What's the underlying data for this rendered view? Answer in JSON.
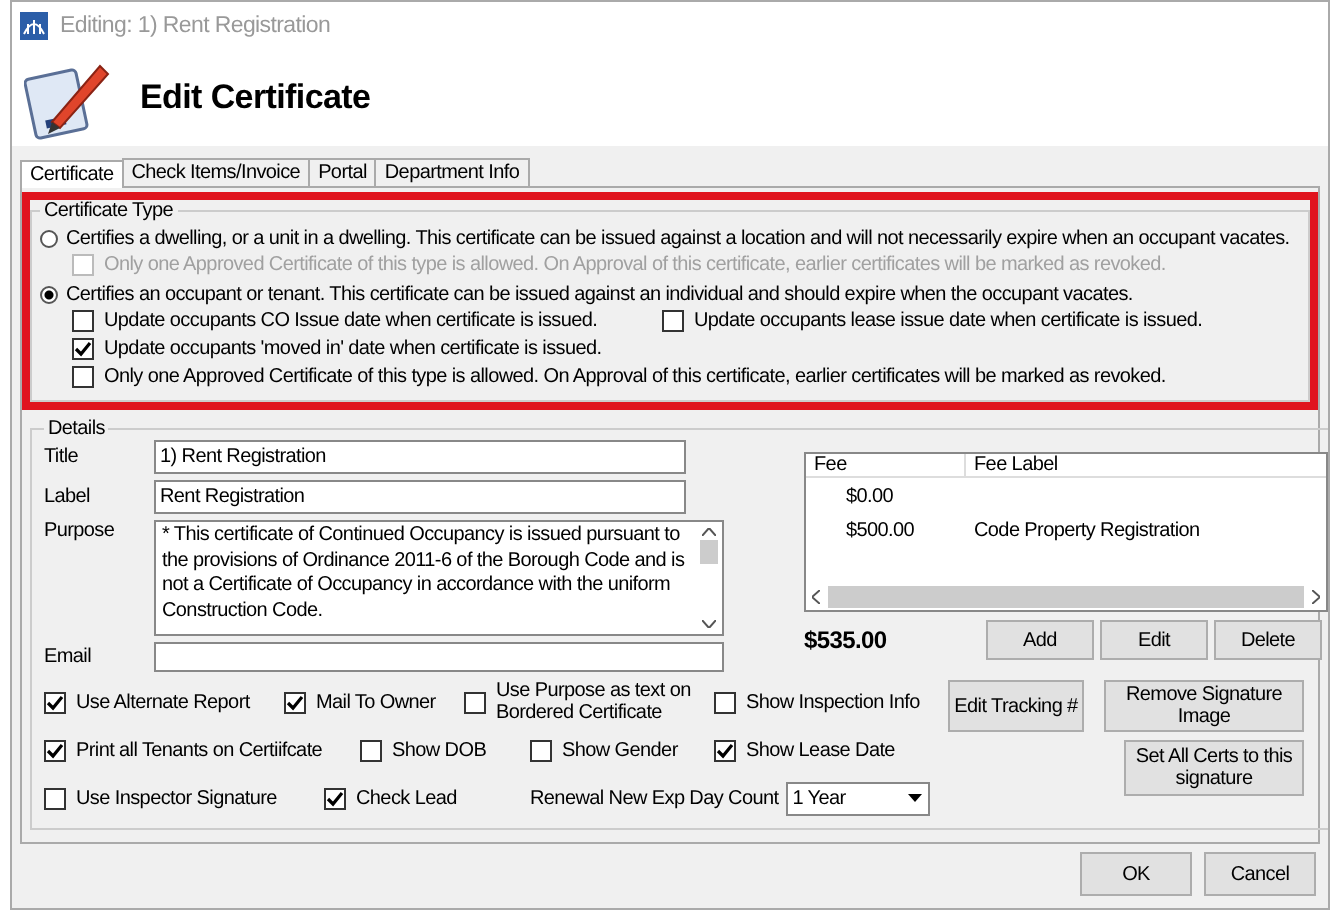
{
  "window": {
    "title": "Editing: 1) Rent Registration"
  },
  "header": {
    "title": "Edit Certificate"
  },
  "tabs": [
    {
      "label": "Certificate",
      "selected": true
    },
    {
      "label": "Check Items/Invoice",
      "selected": false
    },
    {
      "label": "Portal",
      "selected": false
    },
    {
      "label": "Department Info",
      "selected": false
    }
  ],
  "certificate_type": {
    "title": "Certificate Type",
    "highlighted": true,
    "options": [
      {
        "label": "Certifies a dwelling, or a unit in a dwelling. This certificate can be issued against a location and will not necessarily expire when an occupant vacates.",
        "selected": false,
        "suboptions": [
          {
            "label": "Only one Approved Certificate of this type is allowed.  On Approval of this certificate, earlier certificates will be marked as revoked.",
            "checked": false,
            "disabled": true
          }
        ]
      },
      {
        "label": "Certifies an occupant or tenant. This certificate can be issued against an individual and should expire when the occupant vacates.",
        "selected": true,
        "suboptions": [
          {
            "label": "Update occupants CO Issue date when certificate is issued.",
            "checked": false,
            "disabled": false
          },
          {
            "label": "Update occupants lease issue date when certificate is issued.",
            "checked": false,
            "disabled": false
          },
          {
            "label": "Update occupants 'moved in' date when certificate is issued.",
            "checked": true,
            "disabled": false
          },
          {
            "label": "Only one Approved Certificate of this type is allowed.  On Approval of this certificate, earlier certificates will be marked as revoked.",
            "checked": false,
            "disabled": false
          }
        ]
      }
    ]
  },
  "details": {
    "title": "Details",
    "fields": [
      {
        "label": "Title",
        "value": "1) Rent Registration"
      },
      {
        "label": "Label",
        "value": "Rent Registration"
      }
    ],
    "purpose": {
      "label": "Purpose",
      "value": "* This certificate of Continued Occupancy is issued pursuant to the provisions of Ordinance 2011-6 of the Borough Code and is not a Certificate of Occupancy in accordance with the uniform Construction Code."
    },
    "email": {
      "label": "Email"
    },
    "fees": {
      "columns": [
        "Fee",
        "Fee Label"
      ],
      "rows": [
        {
          "fee": "$0.00",
          "label": ""
        },
        {
          "fee": "$500.00",
          "label": "Code Property Registration"
        }
      ],
      "total": "$535.00",
      "buttons": [
        "Add",
        "Edit",
        "Delete"
      ]
    },
    "option_rows": [
      [
        {
          "label": "Use Alternate Report",
          "checked": true
        },
        {
          "label": "Mail To Owner",
          "checked": true
        },
        {
          "label": "Use Purpose as text on Bordered Certificate",
          "checked": false
        },
        {
          "label": "Show Inspection Info",
          "checked": false
        }
      ],
      [
        {
          "label": "Print all Tenants on Certiifcate",
          "checked": true
        },
        {
          "label": "Show DOB",
          "checked": false
        },
        {
          "label": "Show Gender",
          "checked": false
        },
        {
          "label": "Show Lease Date",
          "checked": true
        }
      ],
      [
        {
          "label": "Use Inspector Signature",
          "checked": false
        },
        {
          "label": "Check Lead",
          "checked": true
        }
      ]
    ],
    "renewal": {
      "label": "Renewal New Exp Day Count",
      "value": "1 Year"
    },
    "side_buttons": [
      "Edit Tracking #",
      "Remove Signature Image",
      "Set All Certs to this signature"
    ]
  },
  "footer_buttons": [
    {
      "label": "OK"
    },
    {
      "label": "Cancel"
    }
  ]
}
